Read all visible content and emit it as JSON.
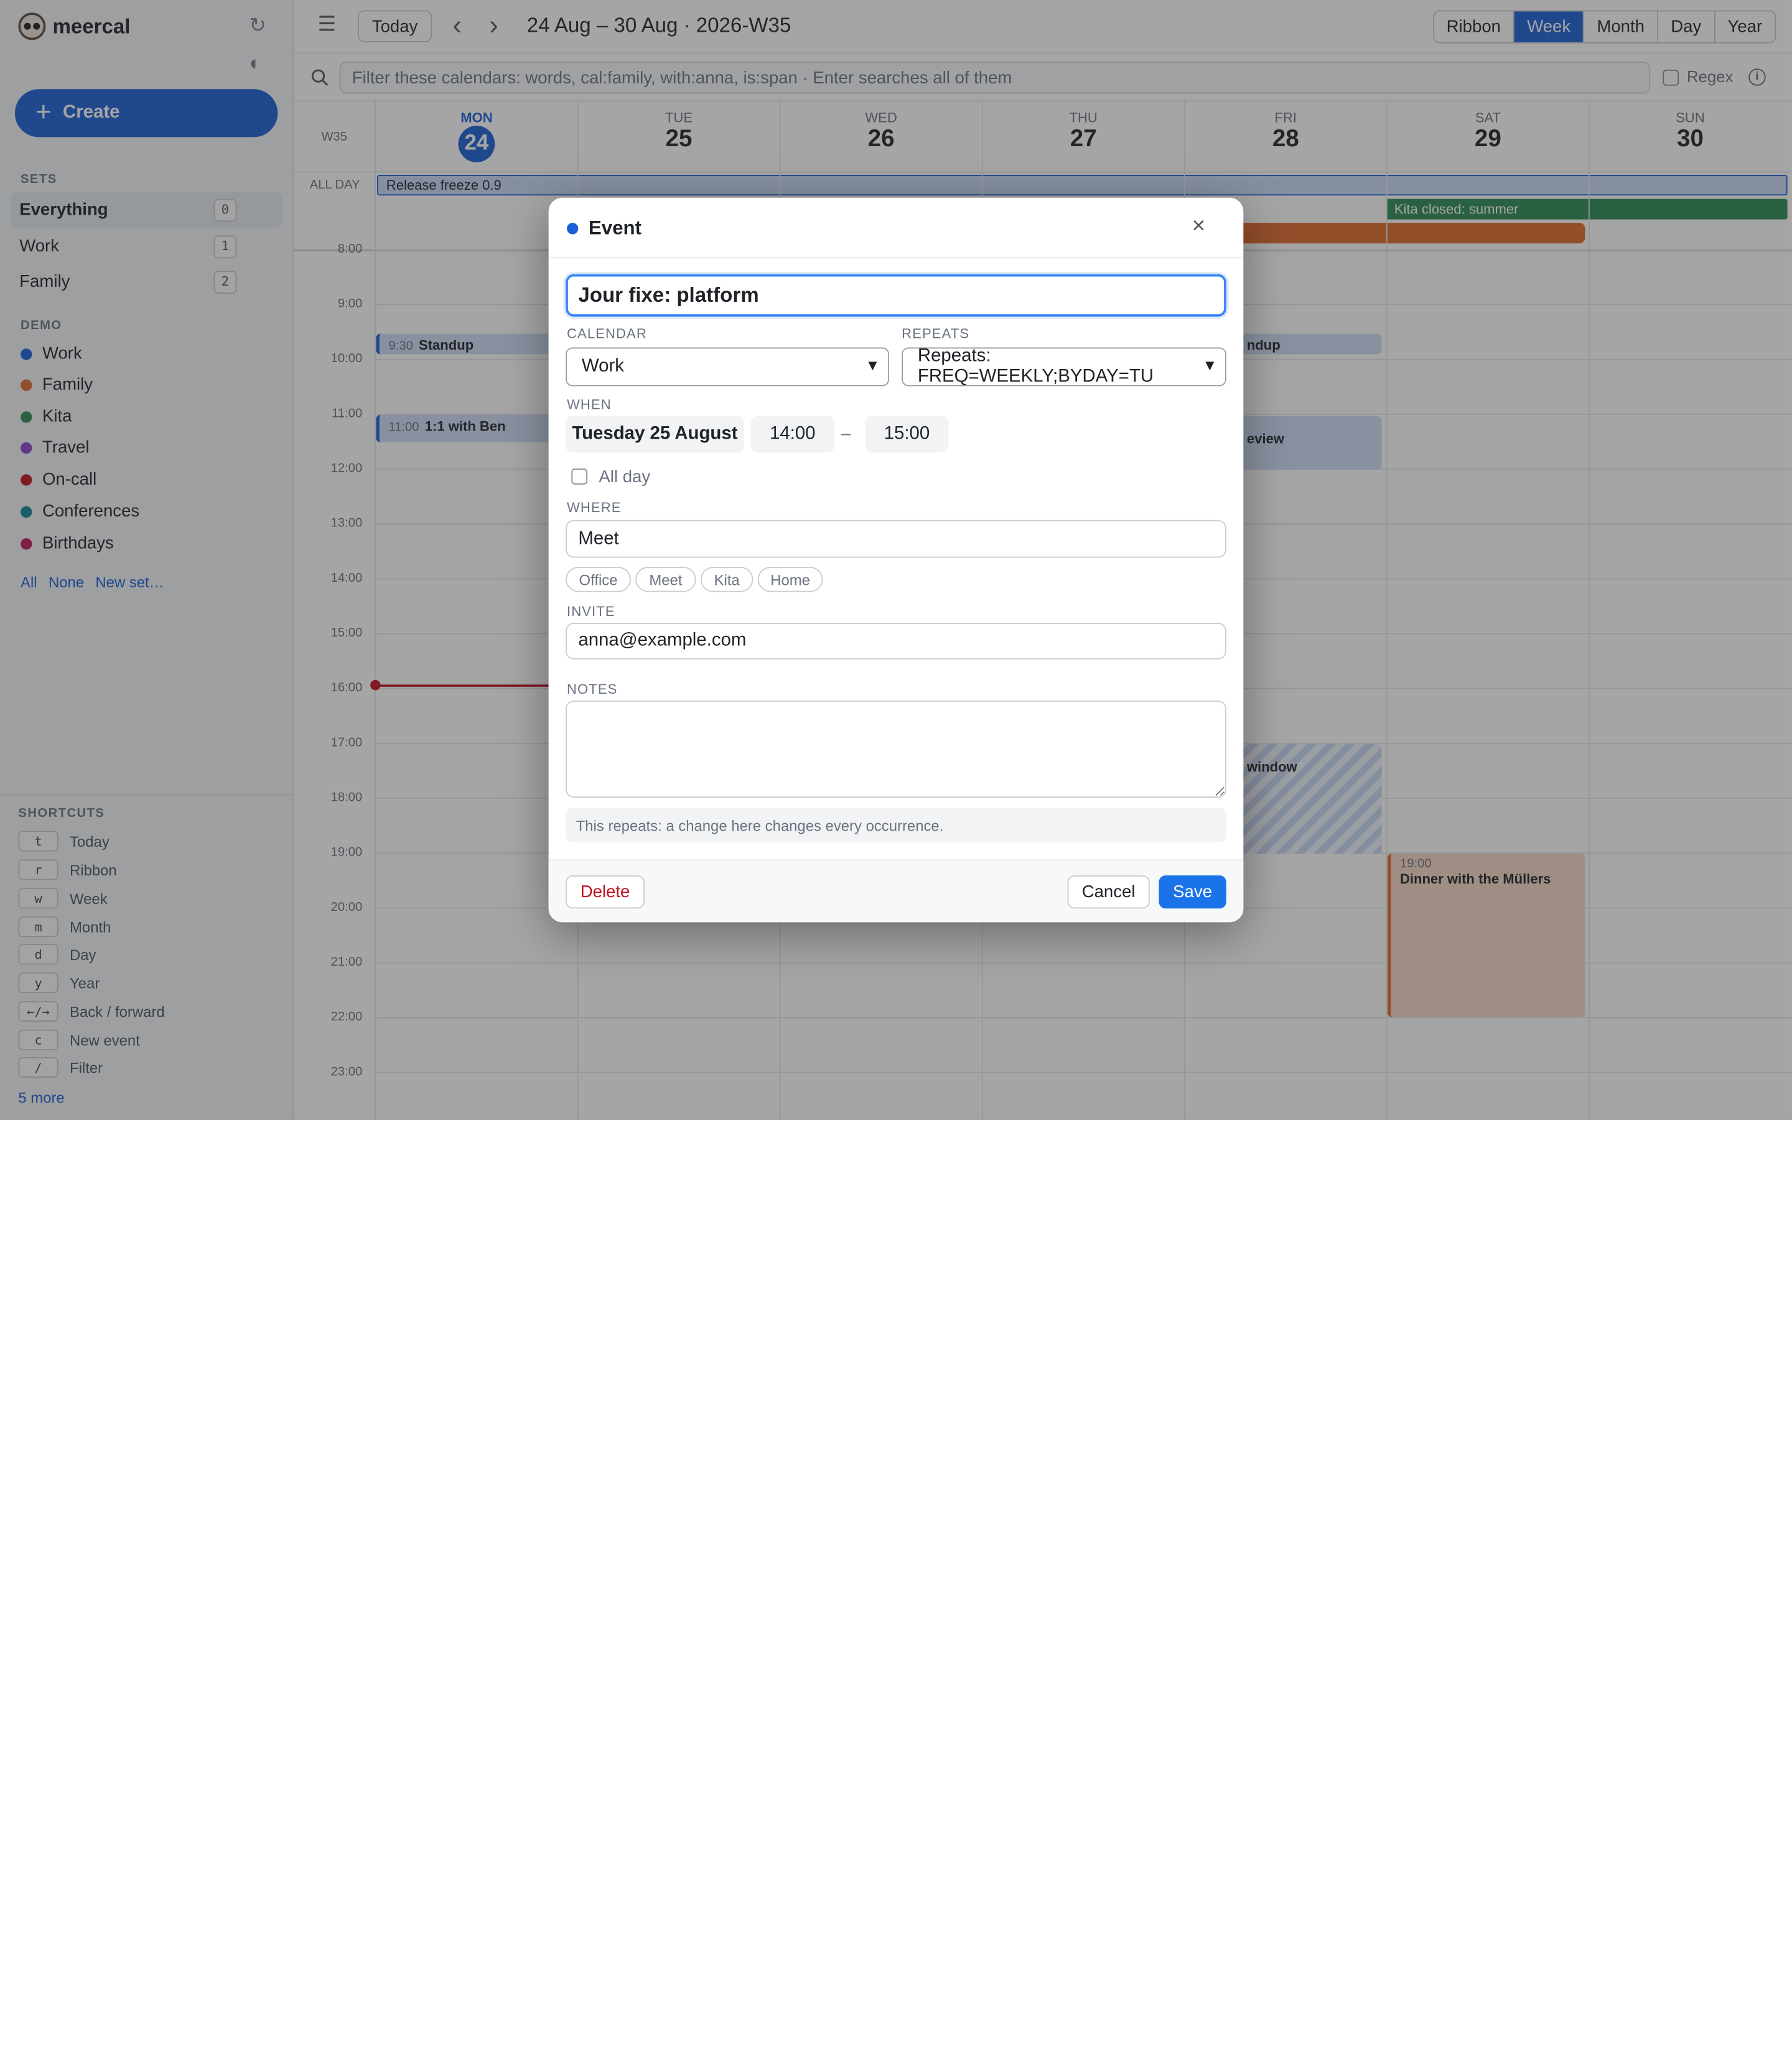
{
  "app": {
    "name": "meercal"
  },
  "sidebar": {
    "create_label": "Create",
    "sets_title": "SETS",
    "sets": [
      {
        "label": "Everything",
        "count": "0",
        "active": true
      },
      {
        "label": "Work",
        "count": "1"
      },
      {
        "label": "Family",
        "count": "2"
      }
    ],
    "demo_title": "DEMO",
    "calendars": [
      {
        "label": "Work",
        "color": "#1a5fd6"
      },
      {
        "label": "Family",
        "color": "#e06a2c"
      },
      {
        "label": "Kita",
        "color": "#2e8b57"
      },
      {
        "label": "Travel",
        "color": "#8a44c9"
      },
      {
        "label": "On-call",
        "color": "#c1121f"
      },
      {
        "label": "Conferences",
        "color": "#12869a"
      },
      {
        "label": "Birthdays",
        "color": "#c2185b"
      }
    ],
    "links": {
      "all": "All",
      "none": "None",
      "new_set": "New set…"
    },
    "shortcuts_title": "SHORTCUTS",
    "shortcuts": [
      {
        "key": "t",
        "label": "Today"
      },
      {
        "key": "r",
        "label": "Ribbon"
      },
      {
        "key": "w",
        "label": "Week"
      },
      {
        "key": "m",
        "label": "Month"
      },
      {
        "key": "d",
        "label": "Day"
      },
      {
        "key": "y",
        "label": "Year"
      },
      {
        "key": "←/→",
        "label": "Back / forward"
      },
      {
        "key": "c",
        "label": "New event"
      },
      {
        "key": "/",
        "label": "Filter"
      }
    ],
    "more_label": "5 more"
  },
  "toolbar": {
    "today_label": "Today",
    "prev_glyph": "‹",
    "next_glyph": "›",
    "range_title": "24 Aug – 30 Aug · 2026-W35",
    "views": [
      "Ribbon",
      "Week",
      "Month",
      "Day",
      "Year"
    ],
    "selected_view": "Week"
  },
  "filter": {
    "placeholder": "Filter these calendars: words, cal:family, with:anna, is:span · Enter searches all of them",
    "regex_label": "Regex"
  },
  "week": {
    "week_label": "W35",
    "allday_label": "ALL DAY",
    "days": [
      {
        "name": "MON",
        "num": "24",
        "today": true
      },
      {
        "name": "TUE",
        "num": "25"
      },
      {
        "name": "WED",
        "num": "26"
      },
      {
        "name": "THU",
        "num": "27"
      },
      {
        "name": "FRI",
        "num": "28"
      },
      {
        "name": "SAT",
        "num": "29"
      },
      {
        "name": "SUN",
        "num": "30"
      }
    ],
    "hours": [
      "8:00",
      "9:00",
      "10:00",
      "11:00",
      "12:00",
      "13:00",
      "14:00",
      "15:00",
      "16:00",
      "17:00",
      "18:00",
      "19:00",
      "20:00",
      "21:00",
      "22:00",
      "23:00"
    ],
    "allday_events": [
      {
        "title": "Release freeze 0.9",
        "color": "#1a5fd6"
      },
      {
        "title": "Kita closed: summer",
        "color": "#2e8b57"
      },
      {
        "title": "",
        "color": "#e06a2c"
      }
    ],
    "events": [
      {
        "time": "9:30",
        "title": "Standup"
      },
      {
        "time": "",
        "title": "ndup"
      },
      {
        "time": "11:00",
        "title": "1:1 with Ben"
      },
      {
        "time": "",
        "title": "eview"
      },
      {
        "time": "",
        "title": "window"
      },
      {
        "time": "19:00",
        "title": "Dinner with the Müllers"
      }
    ]
  },
  "modal": {
    "title": "Event",
    "close_glyph": "×",
    "event_title": "Jour fixe: platform",
    "calendar_label": "CALENDAR",
    "calendar_value": "Work",
    "repeats_label": "REPEATS",
    "repeats_value": "Repeats: FREQ=WEEKLY;BYDAY=TU",
    "when_label": "WHEN",
    "date": "Tuesday 25 August",
    "start": "14:00",
    "dash": "–",
    "end": "15:00",
    "allday_label": "All day",
    "where_label": "WHERE",
    "where_value": "Meet",
    "where_chips": [
      "Office",
      "Meet",
      "Kita",
      "Home"
    ],
    "invite_label": "INVITE",
    "invite_value": "anna@example.com",
    "notes_label": "NOTES",
    "notes_value": "",
    "repeat_note": "This repeats: a change here changes every occurrence.",
    "delete_label": "Delete",
    "cancel_label": "Cancel",
    "save_label": "Save"
  }
}
